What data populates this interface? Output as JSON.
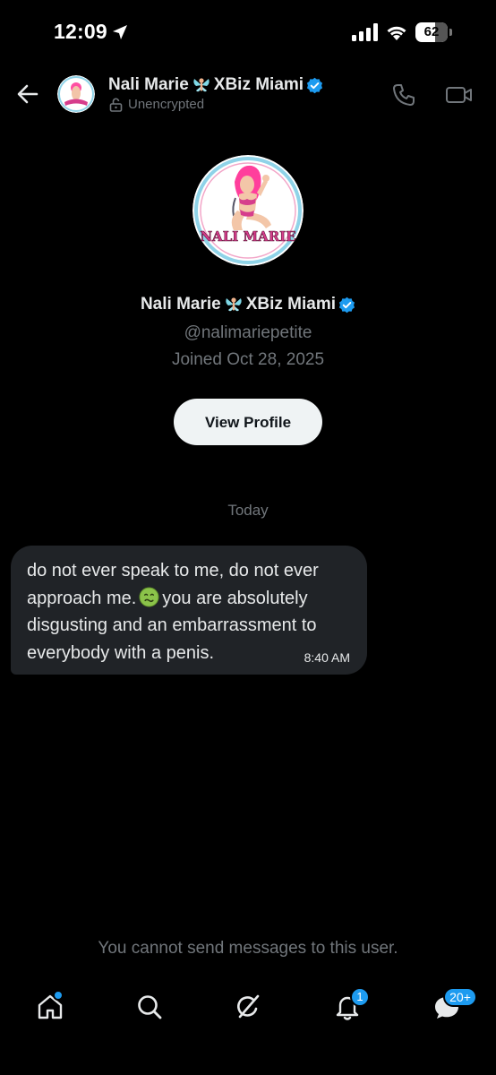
{
  "status_bar": {
    "time": "12:09",
    "battery": "62",
    "battery_level": 0.62
  },
  "header": {
    "name": "Nali Marie",
    "name_suffix": "XBiz Miami",
    "encryption_status": "Unencrypted"
  },
  "profile": {
    "name": "Nali Marie",
    "name_suffix": "XBiz Miami",
    "handle": "@nalimariepetite",
    "joined": "Joined Oct 28, 2025",
    "view_profile_label": "View Profile",
    "avatar_logo_text": "NALI MARIE"
  },
  "conversation": {
    "date_separator": "Today",
    "messages": [
      {
        "text_before_emoji": "do not ever speak to me, do not ever approach me.",
        "emoji": "nauseated-face-icon",
        "text_after_emoji": "you are absolutely disgusting and an embarrassment to everybody with a penis.",
        "time": "8:40 AM"
      }
    ]
  },
  "footer": {
    "notice": "You cannot send messages to this user."
  },
  "tab_bar": {
    "home_icon": "home-icon",
    "search_icon": "search-icon",
    "grok_icon": "grok-icon",
    "notifications_icon": "bell-icon",
    "notifications_badge": "1",
    "messages_icon": "messages-icon",
    "messages_badge": "20+"
  },
  "colors": {
    "background": "#000000",
    "accent": "#1d9bf0",
    "secondary_text": "#71767b",
    "bubble": "#202327"
  }
}
